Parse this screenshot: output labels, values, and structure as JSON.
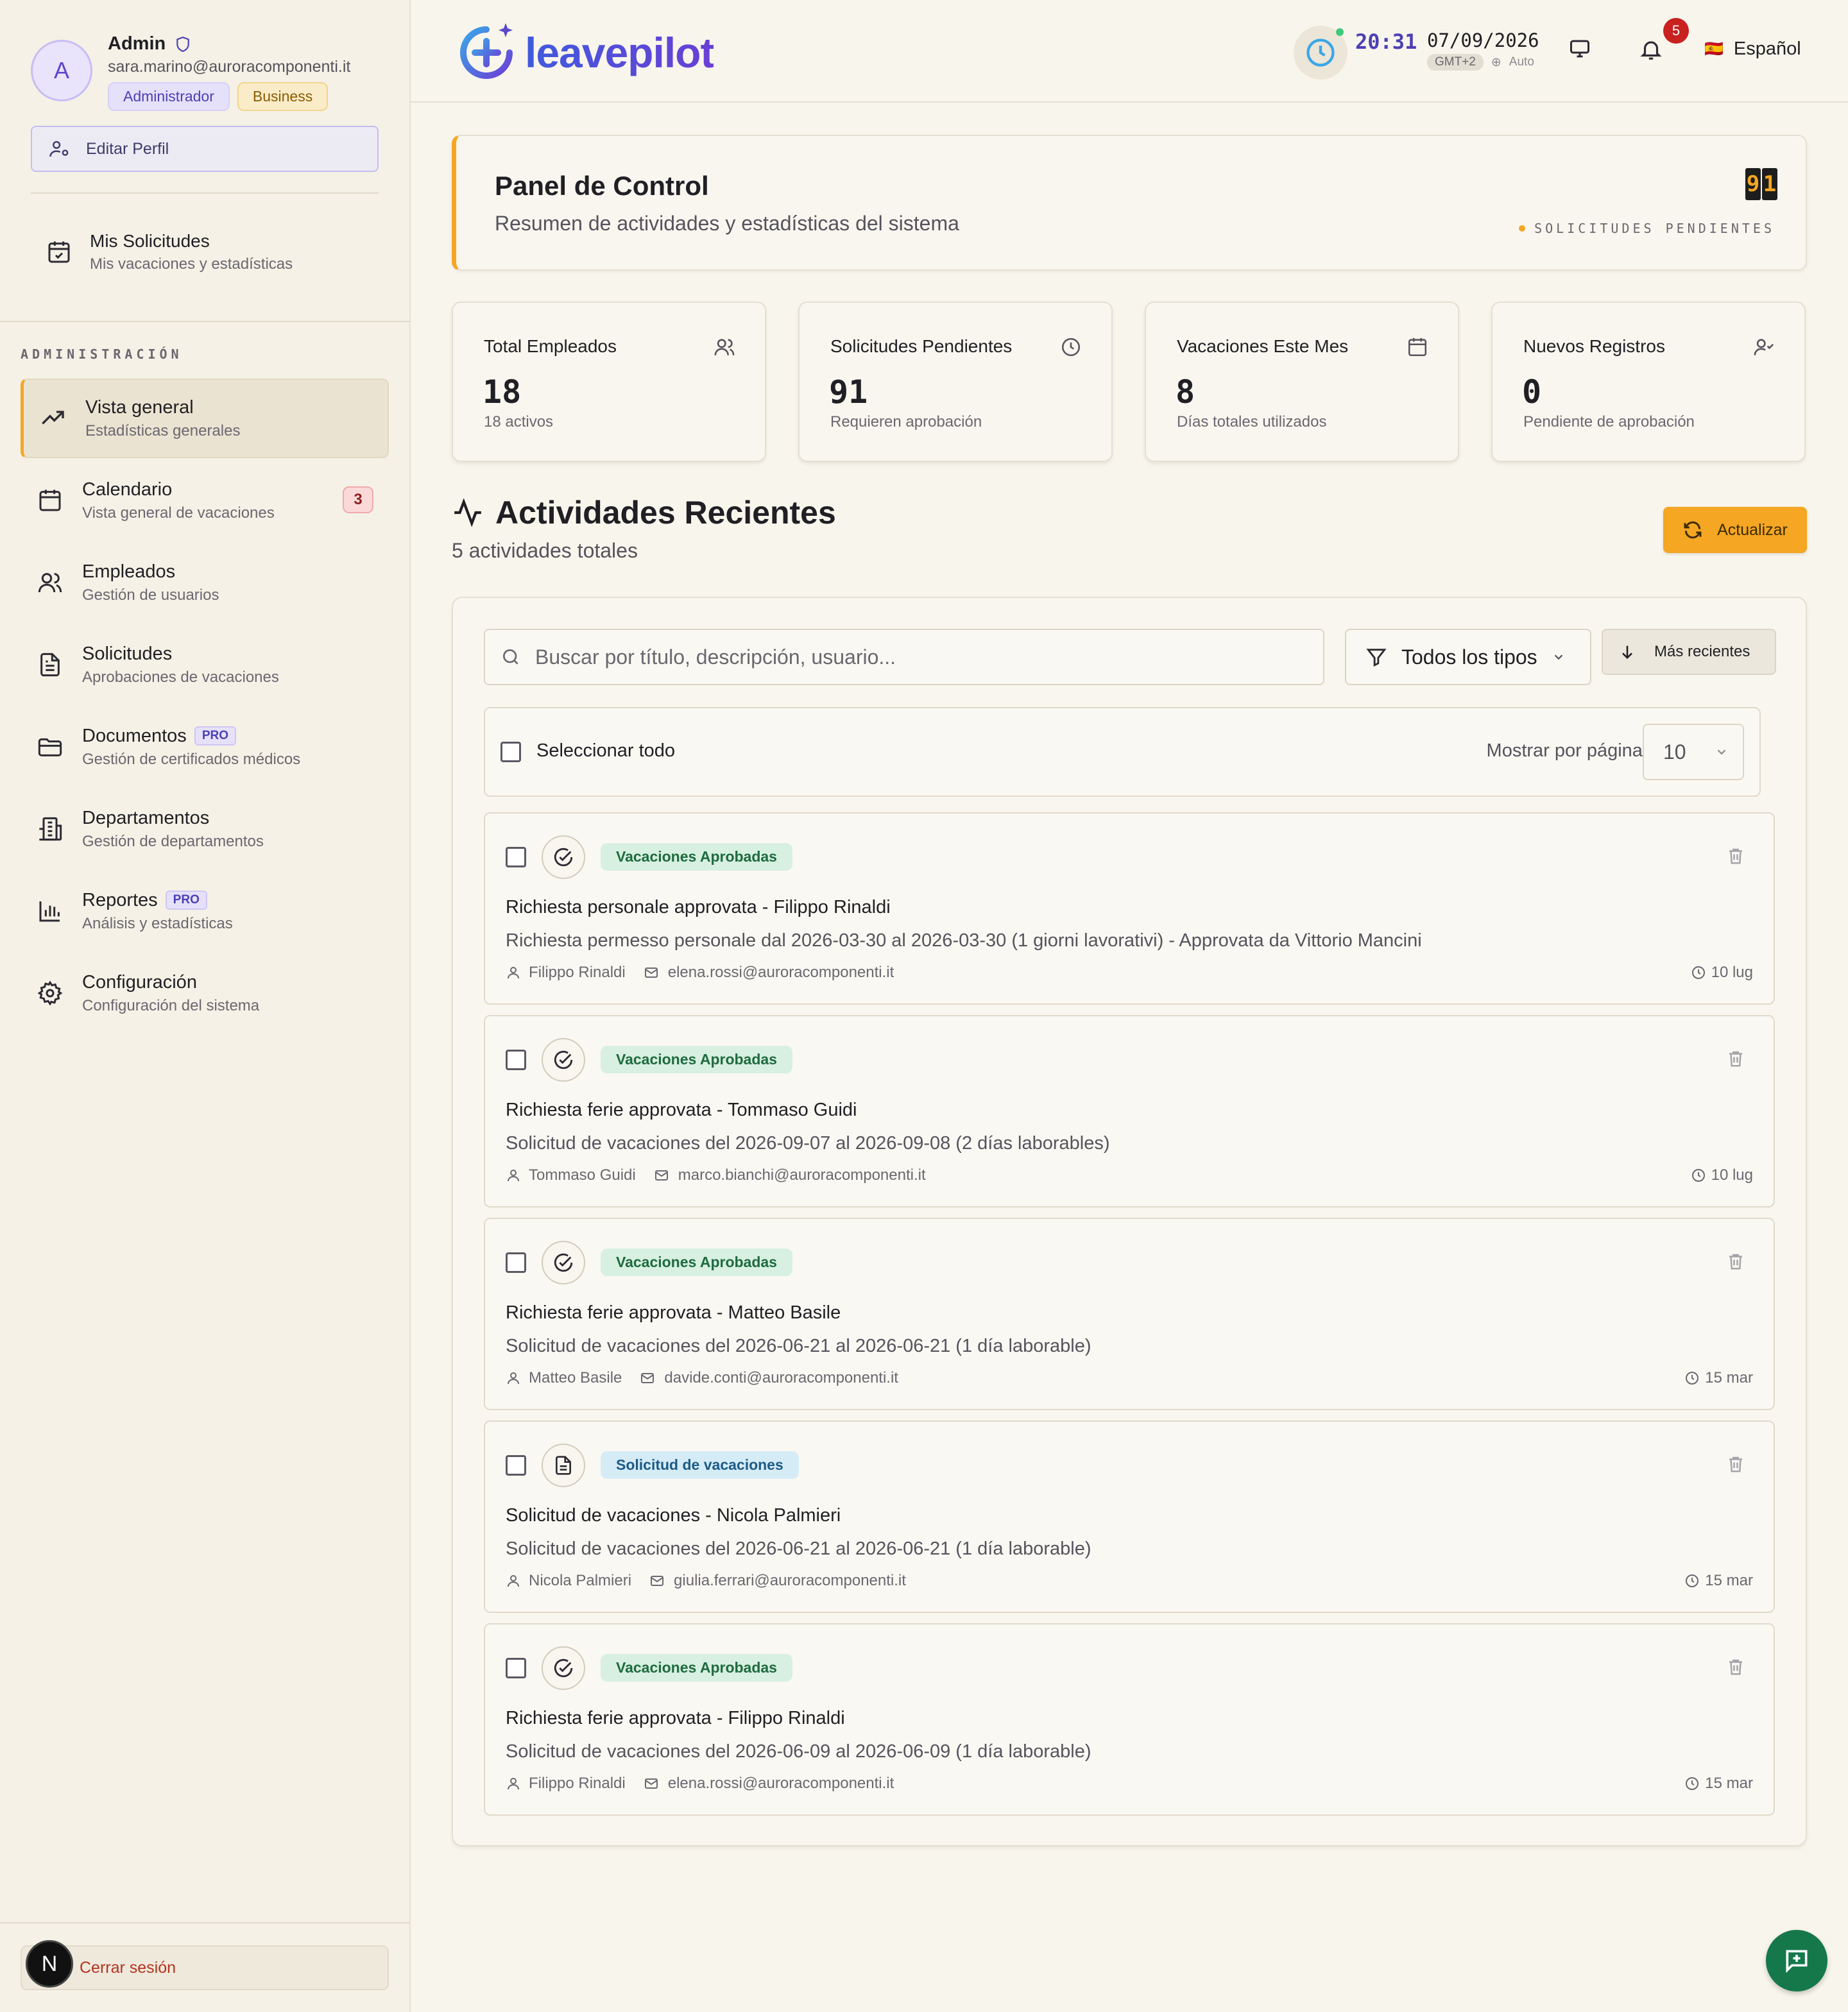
{
  "profile": {
    "initial": "A",
    "name": "Admin",
    "email": "sara.marino@auroracomponenti.it",
    "role_badge": "Administrador",
    "plan_badge": "Business",
    "edit_label": "Editar Perfil"
  },
  "my_requests": {
    "title": "Mis Solicitudes",
    "subtitle": "Mis vacaciones y estadísticas"
  },
  "sidebar": {
    "section_label": "ADMINISTRACIÓN",
    "items": [
      {
        "label": "Vista general",
        "sub": "Estadísticas generales",
        "icon": "trend-up-icon",
        "active": true
      },
      {
        "label": "Calendario",
        "sub": "Vista general de vacaciones",
        "icon": "calendar-icon",
        "badge": "3"
      },
      {
        "label": "Empleados",
        "sub": "Gestión de usuarios",
        "icon": "users-icon"
      },
      {
        "label": "Solicitudes",
        "sub": "Aprobaciones de vacaciones",
        "icon": "document-icon"
      },
      {
        "label": "Documentos",
        "sub": "Gestión de certificados médicos",
        "icon": "folder-icon",
        "pro": "PRO"
      },
      {
        "label": "Departamentos",
        "sub": "Gestión de departamentos",
        "icon": "building-icon"
      },
      {
        "label": "Reportes",
        "sub": "Análisis y estadísticas",
        "icon": "bar-chart-icon",
        "pro": "PRO"
      },
      {
        "label": "Configuración",
        "sub": "Configuración del sistema",
        "icon": "gear-icon"
      }
    ],
    "logout_label": "Cerrar sesión",
    "next_initial": "N"
  },
  "header": {
    "logo_text": "leavepilot",
    "time": "20:31",
    "date": "07/09/2026",
    "timezone": "GMT+2",
    "tz_mode": "Auto",
    "notification_count": "5",
    "language_flag": "🇪🇸",
    "language": "Español"
  },
  "panel": {
    "title": "Panel de Control",
    "subtitle": "Resumen de actividades y estadísticas del sistema",
    "counter_digits": [
      "9",
      "1"
    ],
    "counter_label": "SOLICITUDES PENDIENTES"
  },
  "stats": [
    {
      "label": "Total Empleados",
      "value": "18",
      "note": "18 activos",
      "icon": "users-icon"
    },
    {
      "label": "Solicitudes Pendientes",
      "value": "91",
      "note": "Requieren aprobación",
      "icon": "clock-icon"
    },
    {
      "label": "Vacaciones Este Mes",
      "value": "8",
      "note": "Días totales utilizados",
      "icon": "calendar-icon"
    },
    {
      "label": "Nuevos Registros",
      "value": "0",
      "note": "Pendiente de aprobación",
      "icon": "user-check-icon"
    }
  ],
  "activities": {
    "title": "Actividades Recientes",
    "subtitle": "5 actividades totales",
    "refresh_label": "Actualizar",
    "search_placeholder": "Buscar por título, descripción, usuario...",
    "type_filter": "Todos los tipos",
    "sort_label": "Más recientes",
    "select_all": "Seleccionar todo",
    "per_page_label": "Mostrar por página:",
    "per_page_value": "10",
    "items": [
      {
        "tag": "Vacaciones Aprobadas",
        "tag_kind": "approved",
        "title": "Richiesta personale approvata - Filippo Rinaldi",
        "desc": "Richiesta permesso personale dal 2026-03-30 al 2026-03-30 (1 giorni lavorativi) - Approvata da Vittorio Mancini",
        "user": "Filippo Rinaldi",
        "email": "elena.rossi@auroracomponenti.it",
        "date": "10 lug"
      },
      {
        "tag": "Vacaciones Aprobadas",
        "tag_kind": "approved",
        "title": "Richiesta ferie approvata - Tommaso Guidi",
        "desc": "Solicitud de vacaciones del 2026-09-07 al 2026-09-08 (2 días laborables)",
        "user": "Tommaso Guidi",
        "email": "marco.bianchi@auroracomponenti.it",
        "date": "10 lug"
      },
      {
        "tag": "Vacaciones Aprobadas",
        "tag_kind": "approved",
        "title": "Richiesta ferie approvata - Matteo Basile",
        "desc": "Solicitud de vacaciones del 2026-06-21 al 2026-06-21 (1 día laborable)",
        "user": "Matteo Basile",
        "email": "davide.conti@auroracomponenti.it",
        "date": "15 mar"
      },
      {
        "tag": "Solicitud de vacaciones",
        "tag_kind": "request",
        "title": "Solicitud de vacaciones - Nicola Palmieri",
        "desc": "Solicitud de vacaciones del 2026-06-21 al 2026-06-21 (1 día laborable)",
        "user": "Nicola Palmieri",
        "email": "giulia.ferrari@auroracomponenti.it",
        "date": "15 mar"
      },
      {
        "tag": "Vacaciones Aprobadas",
        "tag_kind": "approved",
        "title": "Richiesta ferie approvata - Filippo Rinaldi",
        "desc": "Solicitud de vacaciones del 2026-06-09 al 2026-06-09 (1 día laborable)",
        "user": "Filippo Rinaldi",
        "email": "elena.rossi@auroracomponenti.it",
        "date": "15 mar"
      }
    ]
  },
  "colors": {
    "accent": "#f5a623",
    "brand": "#4c3fb5",
    "success": "#15784b",
    "danger": "#c8211f"
  }
}
